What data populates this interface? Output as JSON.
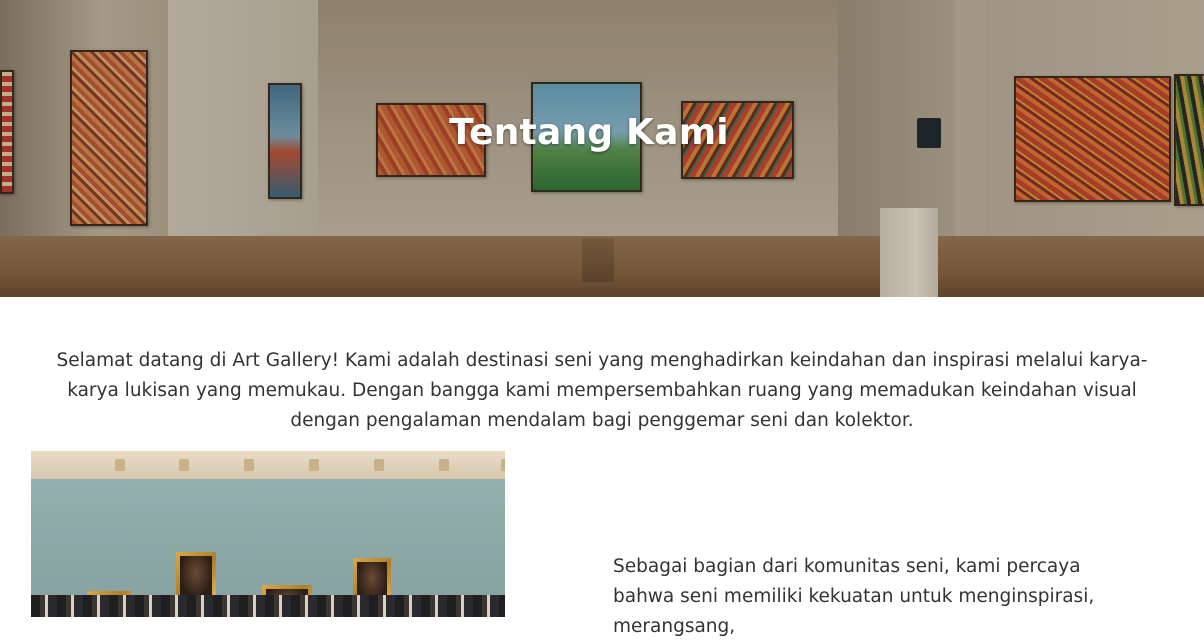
{
  "hero": {
    "title": "Tentang Kami"
  },
  "intro": {
    "text": "Selamat datang di Art Gallery! Kami adalah destinasi seni yang menghadirkan keindahan dan inspirasi melalui karya-karya lukisan yang memukau. Dengan bangga kami mempersembahkan ruang yang memadukan keindahan visual dengan pengalaman mendalam bagi penggemar seni dan kolektor."
  },
  "about": {
    "text": "Sebagai bagian dari komunitas seni, kami percaya bahwa seni memiliki kekuatan untuk menginspirasi, merangsang,"
  },
  "colors": {
    "text": "#333333",
    "hero_title": "#ffffff",
    "background": "#ffffff"
  }
}
